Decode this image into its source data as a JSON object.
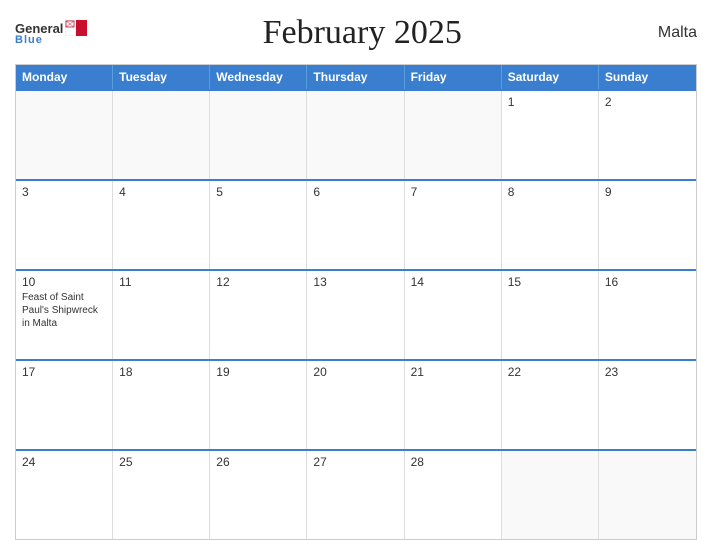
{
  "header": {
    "title": "February 2025",
    "country": "Malta",
    "logo_general": "General",
    "logo_blue": "Blue"
  },
  "days_of_week": [
    "Monday",
    "Tuesday",
    "Wednesday",
    "Thursday",
    "Friday",
    "Saturday",
    "Sunday"
  ],
  "weeks": [
    [
      {
        "day": "",
        "empty": true
      },
      {
        "day": "",
        "empty": true
      },
      {
        "day": "",
        "empty": true
      },
      {
        "day": "",
        "empty": true
      },
      {
        "day": "",
        "empty": true
      },
      {
        "day": "1",
        "empty": false,
        "event": ""
      },
      {
        "day": "2",
        "empty": false,
        "event": ""
      }
    ],
    [
      {
        "day": "3",
        "empty": false,
        "event": ""
      },
      {
        "day": "4",
        "empty": false,
        "event": ""
      },
      {
        "day": "5",
        "empty": false,
        "event": ""
      },
      {
        "day": "6",
        "empty": false,
        "event": ""
      },
      {
        "day": "7",
        "empty": false,
        "event": ""
      },
      {
        "day": "8",
        "empty": false,
        "event": ""
      },
      {
        "day": "9",
        "empty": false,
        "event": ""
      }
    ],
    [
      {
        "day": "10",
        "empty": false,
        "event": "Feast of Saint Paul's Shipwreck in Malta"
      },
      {
        "day": "11",
        "empty": false,
        "event": ""
      },
      {
        "day": "12",
        "empty": false,
        "event": ""
      },
      {
        "day": "13",
        "empty": false,
        "event": ""
      },
      {
        "day": "14",
        "empty": false,
        "event": ""
      },
      {
        "day": "15",
        "empty": false,
        "event": ""
      },
      {
        "day": "16",
        "empty": false,
        "event": ""
      }
    ],
    [
      {
        "day": "17",
        "empty": false,
        "event": ""
      },
      {
        "day": "18",
        "empty": false,
        "event": ""
      },
      {
        "day": "19",
        "empty": false,
        "event": ""
      },
      {
        "day": "20",
        "empty": false,
        "event": ""
      },
      {
        "day": "21",
        "empty": false,
        "event": ""
      },
      {
        "day": "22",
        "empty": false,
        "event": ""
      },
      {
        "day": "23",
        "empty": false,
        "event": ""
      }
    ],
    [
      {
        "day": "24",
        "empty": false,
        "event": ""
      },
      {
        "day": "25",
        "empty": false,
        "event": ""
      },
      {
        "day": "26",
        "empty": false,
        "event": ""
      },
      {
        "day": "27",
        "empty": false,
        "event": ""
      },
      {
        "day": "28",
        "empty": false,
        "event": ""
      },
      {
        "day": "",
        "empty": true
      },
      {
        "day": "",
        "empty": true
      }
    ]
  ],
  "colors": {
    "header_bg": "#3a7ecf",
    "border_accent": "#3a7ecf"
  }
}
